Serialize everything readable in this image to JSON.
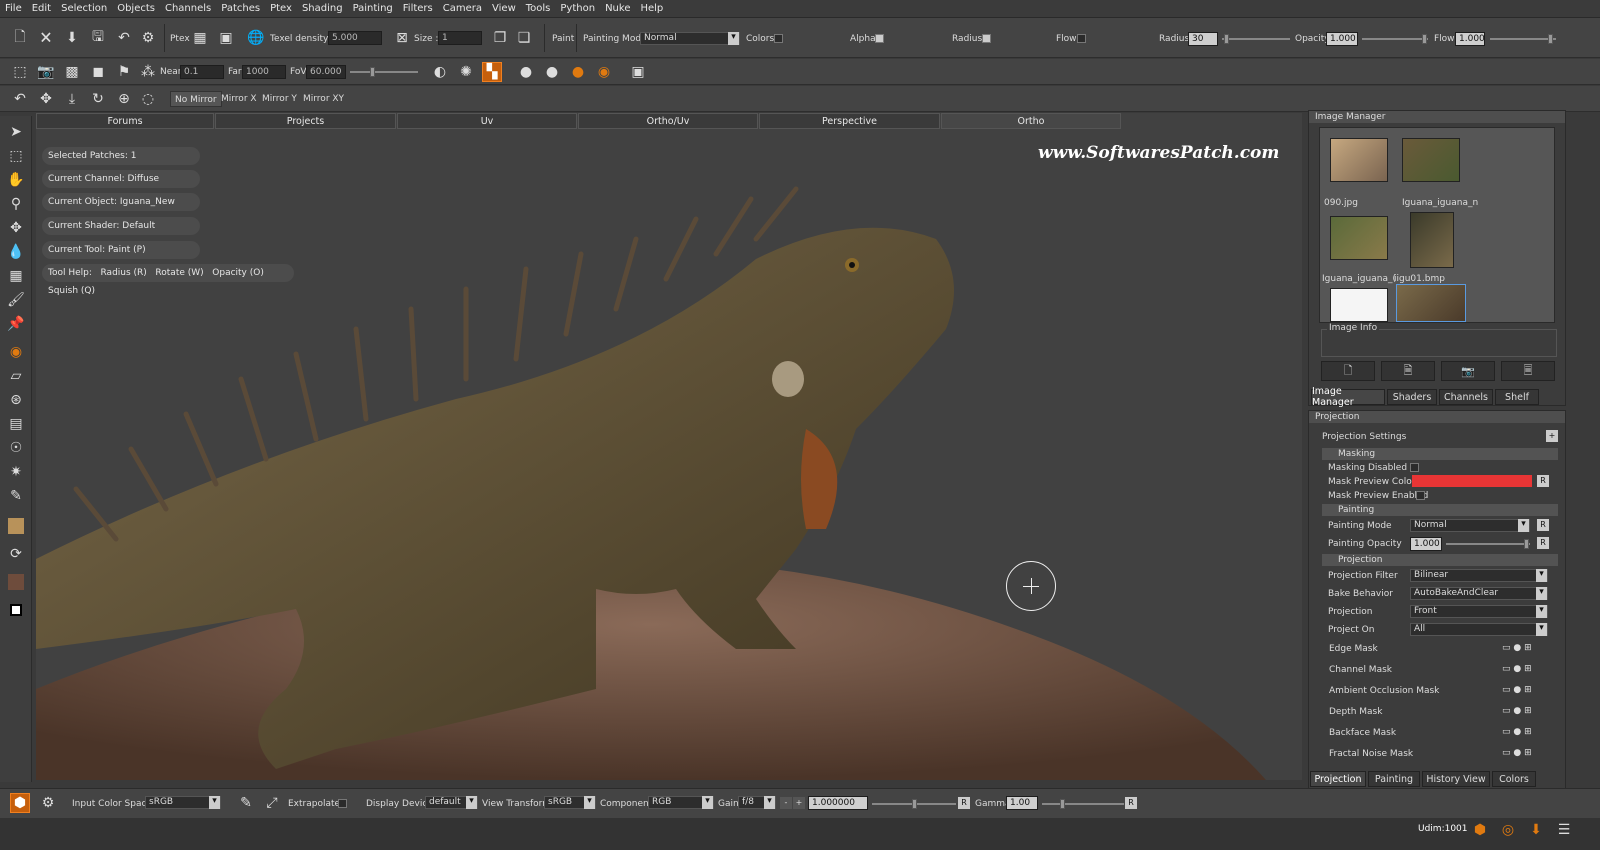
{
  "menu": [
    "File",
    "Edit",
    "Selection",
    "Objects",
    "Channels",
    "Patches",
    "Ptex",
    "Shading",
    "Painting",
    "Filters",
    "Camera",
    "View",
    "Tools",
    "Python",
    "Nuke",
    "Help"
  ],
  "toolbar1": {
    "ptex": "Ptex",
    "texel_density": "Texel density :",
    "texel_value": "5.000",
    "size": "Size :",
    "size_value": "1",
    "paint": "Paint",
    "painting_mode": "Painting Mode",
    "painting_mode_value": "Normal",
    "colors": "Colors",
    "alpha": "Alpha",
    "radius": "Radius",
    "flow": "Flow",
    "radius_label": "Radius",
    "radius_value": "30",
    "opacity_label": "Opacity",
    "opacity_value": "1.000",
    "flow_label": "Flow",
    "flow_value": "1.000"
  },
  "toolbar2": {
    "near": "Near",
    "near_value": "0.1",
    "far": "Far",
    "far_value": "1000",
    "fov": "FoV",
    "fov_value": "60.000"
  },
  "toolbar3": {
    "no_mirror": "No Mirror",
    "mirror_x": "Mirror X",
    "mirror_y": "Mirror Y",
    "mirror_xy": "Mirror XY"
  },
  "viewport": {
    "tabs": [
      "Forums",
      "Projects",
      "Uv",
      "Ortho/Uv",
      "Perspective",
      "Ortho"
    ],
    "active_tab": "Ortho",
    "overlay": [
      "Selected Patches: 1",
      "Current Channel: Diffuse",
      "Current Object: Iguana_New",
      "Current Shader: Default",
      "Current Tool: Paint (P)"
    ],
    "tool_help": "Tool Help:",
    "tool_help_items": [
      "Radius (R)",
      "Rotate (W)",
      "Opacity (O)",
      "Squish (Q)"
    ],
    "watermark": "www.SoftwaresPatch.com"
  },
  "image_manager": {
    "title": "Image Manager",
    "labels": [
      "090.jpg",
      "Iguana_iguana_n",
      "Iguana_iguana_(",
      "iigu01.bmp"
    ],
    "image_info": "Image Info",
    "tabs": [
      "Image Manager",
      "Shaders",
      "Channels",
      "Shelf"
    ]
  },
  "projection": {
    "title": "Projection",
    "settings": "Projection Settings",
    "masking": "Masking",
    "masking_disabled": "Masking Disabled",
    "mask_preview_color": "Mask Preview Color",
    "mask_preview_enabled": "Mask Preview Enabled",
    "mask_color": "#e83535",
    "painting": "Painting",
    "painting_mode": "Painting Mode",
    "painting_mode_value": "Normal",
    "painting_opacity": "Painting Opacity",
    "painting_opacity_value": "1.000",
    "projection": "Projection",
    "projection_filter": "Projection Filter",
    "projection_filter_value": "Bilinear",
    "bake_behavior": "Bake Behavior",
    "bake_behavior_value": "AutoBakeAndClear",
    "projection_label": "Projection",
    "projection_value": "Front",
    "project_on": "Project On",
    "project_on_value": "All",
    "masks": [
      "Edge Mask",
      "Channel Mask",
      "Ambient Occlusion Mask",
      "Depth Mask",
      "Backface Mask",
      "Fractal Noise Mask"
    ],
    "tabs": [
      "Projection",
      "Painting",
      "History View",
      "Colors"
    ]
  },
  "statusbar": {
    "input_color_space": "Input Color Space",
    "input_color_space_value": "sRGB",
    "extrapolate": "Extrapolate",
    "display_device": "Display Device",
    "display_device_value": "default",
    "view_transform": "View Transform",
    "view_transform_value": "sRGB",
    "component": "Component",
    "component_value": "RGB",
    "gain": "Gain",
    "gain_value": "f/8",
    "gain_number": "1.000000",
    "gamma": "Gamma",
    "gamma_value": "1.00",
    "r": "R",
    "udim": "Udim:1001",
    "minus": "-",
    "plus": "+"
  },
  "accent": "#e07a10"
}
